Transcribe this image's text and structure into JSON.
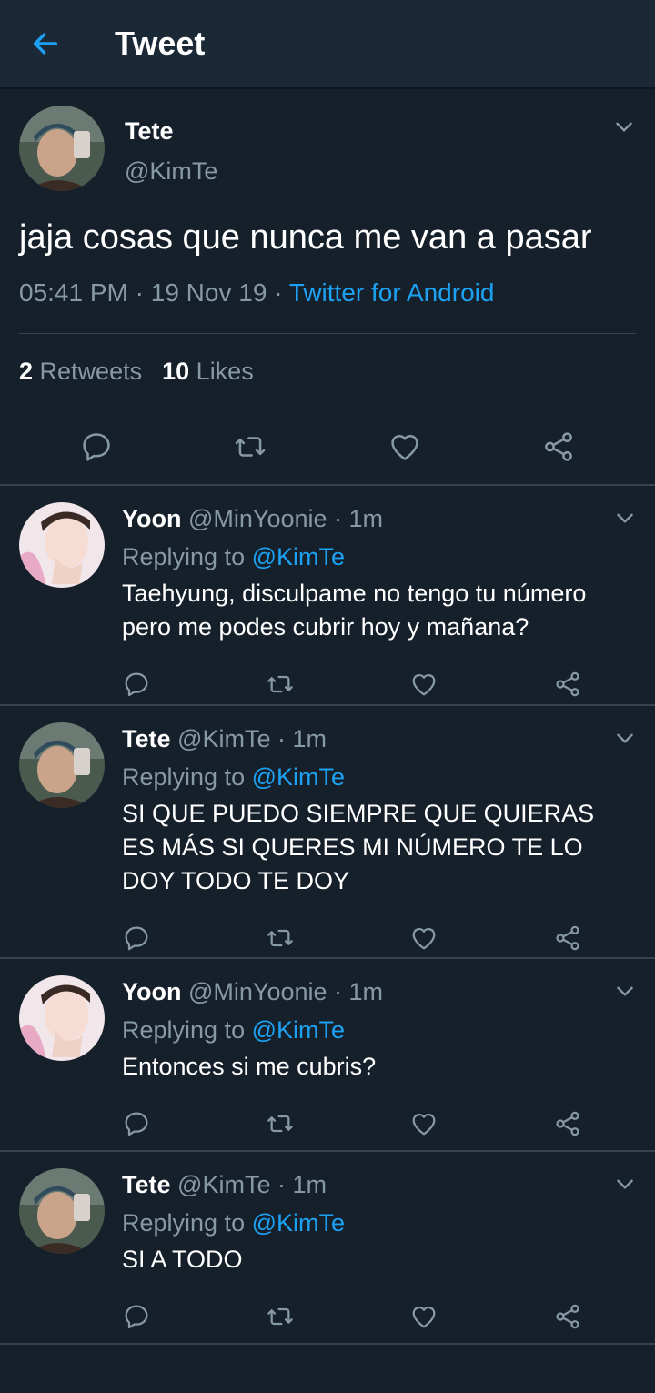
{
  "header": {
    "title": "Tweet",
    "back_icon": "arrow-left-icon"
  },
  "colors": {
    "background": "#15202b",
    "bar": "#1b2836",
    "accent": "#1da1f2",
    "muted": "#8899a6"
  },
  "main_tweet": {
    "name": "Tete",
    "handle": "@KimTe",
    "text": "jaja cosas que nunca me van a pasar",
    "time": "05:41 PM",
    "date": "19 Nov 19",
    "source": "Twitter for Android",
    "retweets_count": "2",
    "retweets_label": "Retweets",
    "likes_count": "10",
    "likes_label": "Likes"
  },
  "replying_label": "Replying to",
  "replies": [
    {
      "name": "Yoon",
      "handle": "@MinYoonie",
      "time": "1m",
      "replying_to": "@KimTe",
      "text": "Taehyung, disculpame no tengo tu número pero me podes cubrir hoy y mañana?"
    },
    {
      "name": "Tete",
      "handle": "@KimTe",
      "time": "1m",
      "replying_to": "@KimTe",
      "text": "SI QUE PUEDO SIEMPRE QUE QUIERAS ES MÁS SI QUERES MI NÚMERO TE LO DOY TODO TE DOY"
    },
    {
      "name": "Yoon",
      "handle": "@MinYoonie",
      "time": "1m",
      "replying_to": "@KimTe",
      "text": "Entonces si me cubris?"
    },
    {
      "name": "Tete",
      "handle": "@KimTe",
      "time": "1m",
      "replying_to": "@KimTe",
      "text": "SI A TODO"
    }
  ]
}
